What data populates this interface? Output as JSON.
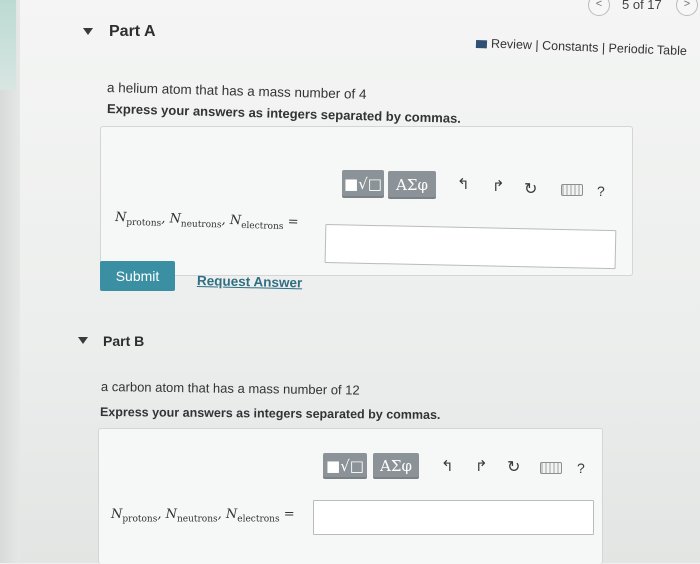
{
  "pager": {
    "prev_label": "<",
    "count": "5 of 17",
    "next_label": ">"
  },
  "review_links": {
    "review": "Review",
    "sep1": " | ",
    "constants": "Constants",
    "sep2": " | ",
    "periodic_table": "Periodic Table"
  },
  "toolbar": {
    "templates_label": "■√□",
    "greek_label": "ΑΣφ",
    "undo_label": "↰",
    "redo_label": "↱",
    "reset_label": "↻",
    "help_label": "?"
  },
  "math": {
    "n": "N",
    "protons": "protons",
    "neutrons": "neutrons",
    "electrons": "electrons",
    "comma": ", ",
    "equals": " ="
  },
  "part_a": {
    "title": "Part A",
    "prompt": "a helium atom that has a mass number of 4",
    "instruction": "Express your answers as integers separated by commas.",
    "answer_value": "",
    "submit_label": "Submit",
    "request_label": "Request Answer"
  },
  "part_b": {
    "title": "Part B",
    "prompt": "a carbon atom that has a mass number of 12",
    "instruction": "Express your answers as integers separated by commas.",
    "answer_value": ""
  },
  "icons": [
    "chevron-left-icon",
    "chevron-right-icon",
    "collapse-triangle-icon",
    "review-icon",
    "undo-icon",
    "redo-icon",
    "reset-icon",
    "keyboard-icon",
    "help-icon"
  ],
  "colors": {
    "submit": "#3a8fa3",
    "link": "#2f6f83",
    "toolbar_button": "#8c9398",
    "accent_bar": "#2f4f73"
  }
}
